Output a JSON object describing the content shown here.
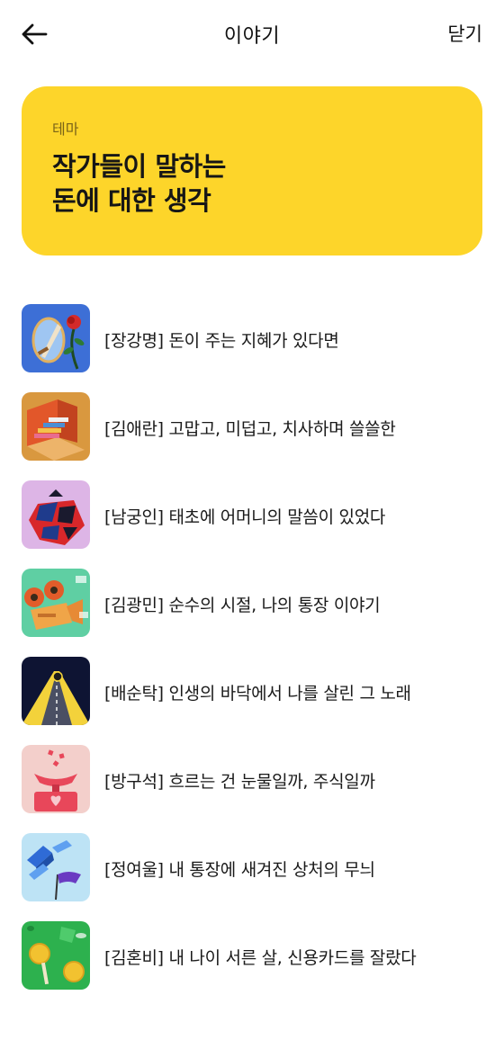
{
  "header": {
    "title": "이야기",
    "close_label": "닫기",
    "back_icon": "arrow-left-icon"
  },
  "banner": {
    "label": "테마",
    "title_line1": "작가들이 말하는",
    "title_line2": "돈에 대한 생각",
    "background": "#FDD52A"
  },
  "stories": [
    {
      "title": "[장강명] 돈이 주는 지혜가 있다면",
      "thumb_bg": "#3D6FD6"
    },
    {
      "title": "[김애란] 고맙고, 미덥고, 치사하며 쓸쓸한",
      "thumb_bg": "#D9983F"
    },
    {
      "title": "[남궁인] 태초에 어머니의 말씀이 있었다",
      "thumb_bg": "#DDB5E6"
    },
    {
      "title": "[김광민] 순수의 시절, 나의 통장 이야기",
      "thumb_bg": "#5FCFA3"
    },
    {
      "title": "[배순탁] 인생의 바닥에서 나를 살린 그 노래",
      "thumb_bg": "#0E1433"
    },
    {
      "title": "[방구석] 흐르는 건 눈물일까, 주식일까",
      "thumb_bg": "#F3CFCB"
    },
    {
      "title": "[정여울] 내 통장에 새겨진 상처의 무늬",
      "thumb_bg": "#BDE3F5"
    },
    {
      "title": "[김혼비] 내 나이 서른 살, 신용카드를 잘랐다",
      "thumb_bg": "#2DB14E"
    }
  ]
}
